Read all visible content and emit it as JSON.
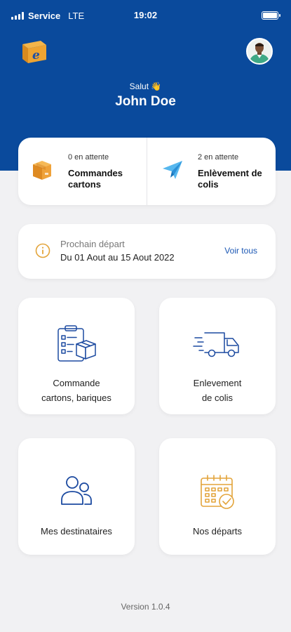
{
  "status_bar": {
    "carrier": "Service",
    "network": "LTE",
    "time": "19:02"
  },
  "header": {
    "greeting": "Salut 👋",
    "username": "John Doe",
    "background_color": "#0a4a9c",
    "logo_icon": "app-logo-box-e",
    "avatar_icon": "user-avatar-photo"
  },
  "stats": [
    {
      "count": "0 en attente",
      "label": "Commandes cartons",
      "icon": "cardboard-box-icon"
    },
    {
      "count": "2 en attente",
      "label": "Enlèvement de colis",
      "icon": "paper-plane-icon"
    }
  ],
  "next_departure": {
    "title": "Prochain départ",
    "dates": "Du 01 Aout au 15 Aout 2022",
    "link": "Voir tous",
    "icon": "info-icon",
    "accent_color": "#e3a43a"
  },
  "tiles": [
    {
      "label_line1": "Commande",
      "label_line2": "cartons, bariques",
      "icon": "clipboard-box-icon"
    },
    {
      "label_line1": "Enlevement",
      "label_line2": "de colis",
      "icon": "delivery-truck-icon"
    },
    {
      "label_line1": "Mes destinataires",
      "icon": "users-icon"
    },
    {
      "label_line1": "Nos départs",
      "icon": "calendar-check-icon"
    }
  ],
  "footer": {
    "version": "Version 1.0.4"
  }
}
